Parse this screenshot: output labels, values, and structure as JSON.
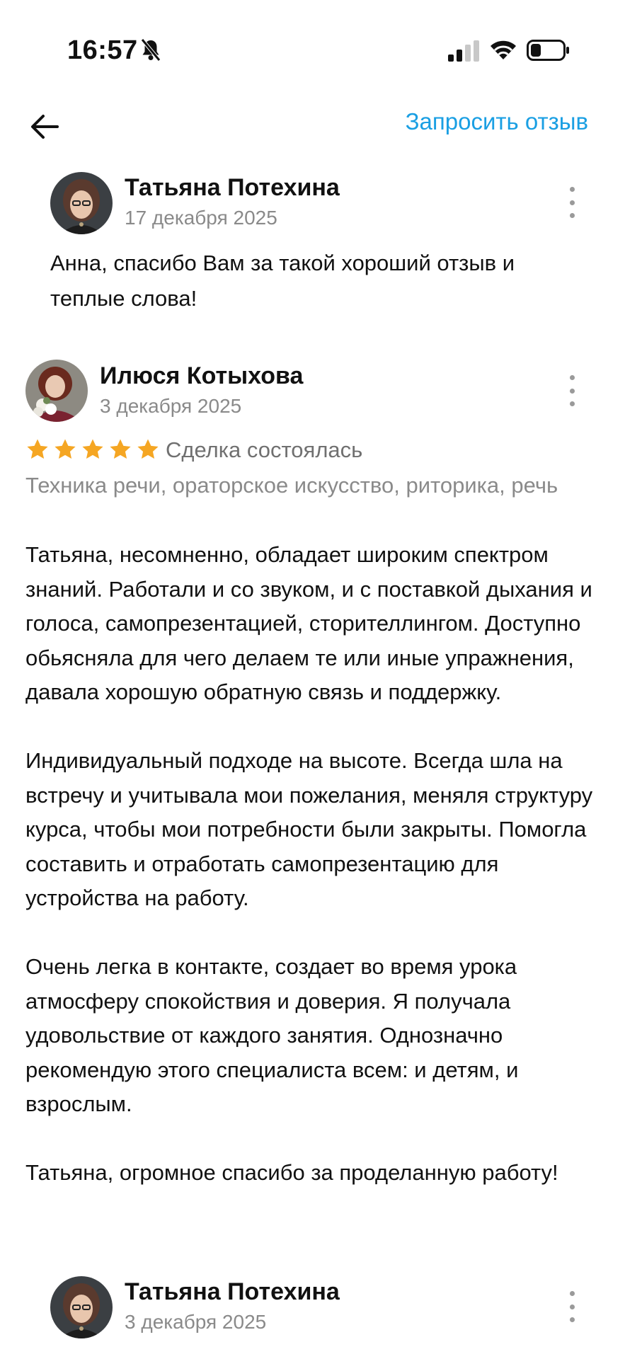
{
  "status_bar": {
    "time": "16:57",
    "icons": [
      "bell-muted-icon",
      "signal-icon",
      "wifi-icon",
      "battery-icon"
    ]
  },
  "header": {
    "back_icon": "arrow-left-icon",
    "request_review_label": "Запросить отзыв",
    "accent_color": "#1a9fe3"
  },
  "reply_1": {
    "author": "Татьяна Потехина",
    "date": "17 декабря 2025",
    "text": "Анна, спасибо Вам за такой хороший отзыв и теплые слова!"
  },
  "review": {
    "author": "Илюся Котыхова",
    "date": "3 декабря 2025",
    "rating": 5,
    "rating_max": 5,
    "star_color": "#f5a623",
    "deal_status": "Сделка состоялась",
    "subject": "Техника речи, ораторское искусство, риторика, речь",
    "paragraphs": [
      "Татьяна, несомненно, обладает широким спектром знаний. Работали и со звуком, и с поставкой  дыхания и голоса, самопрезентацией, сторителлингом. Доступно обьясняла для чего делаем те или иные упражнения, давала хорошую обратную связь и поддержку.",
      "Индивидуальный подходе на высоте. Всегда шла на встречу и учитывала мои пожелания, меняля структуру курса, чтобы мои потребности были закрыты. Помогла составить и отработать самопрезентацию для устройства на работу.",
      "Очень легка в контакте, создает во время урока атмосферу спокойствия и доверия.  Я получала удовольствие от каждого занятия. Однозначно рекомендую этого специалиста всем: и детям, и взрослым.",
      "Татьяна, огромное спасибо за проделанную работу!"
    ]
  },
  "reply_2": {
    "author": "Татьяна Потехина",
    "date": "3 декабря 2025"
  }
}
